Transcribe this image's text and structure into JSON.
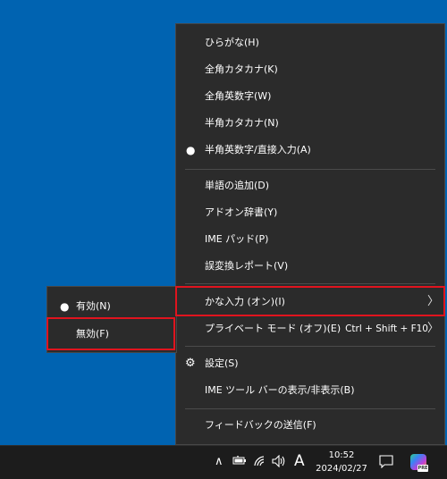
{
  "main_menu": {
    "items": [
      {
        "label": "ひらがな(H)"
      },
      {
        "label": "全角カタカナ(K)"
      },
      {
        "label": "全角英数字(W)"
      },
      {
        "label": "半角カタカナ(N)"
      },
      {
        "label": "半角英数字/直接入力(A)",
        "selected": true
      },
      {
        "label": "単語の追加(D)"
      },
      {
        "label": "アドオン辞書(Y)"
      },
      {
        "label": "IME パッド(P)"
      },
      {
        "label": "誤変換レポート(V)"
      },
      {
        "label": "かな入力 (オン)(I)",
        "has_submenu": true,
        "highlighted": true
      },
      {
        "label": "プライベート モード (オフ)(E)",
        "shortcut": "Ctrl + Shift + F10",
        "has_submenu": true
      },
      {
        "label": "設定(S)",
        "icon": "gear-icon"
      },
      {
        "label": "IME ツール バーの表示/非表示(B)"
      },
      {
        "label": "フィードバックの送信(F)"
      }
    ]
  },
  "sub_menu": {
    "items": [
      {
        "label": "有効(N)",
        "selected": true
      },
      {
        "label": "無効(F)",
        "highlighted": true
      }
    ]
  },
  "bullet_char": "●",
  "arrow_char": "〉",
  "taskbar": {
    "chevron": "∧",
    "ime_indicator": "A",
    "time": "10:52",
    "date": "2024/02/27",
    "copilot_badge": "PRE"
  },
  "colors": {
    "desktop": "#0063b1",
    "menu_bg": "#2b2b2b",
    "highlight_border": "#e0141e",
    "taskbar_bg": "#1c1c1c"
  }
}
